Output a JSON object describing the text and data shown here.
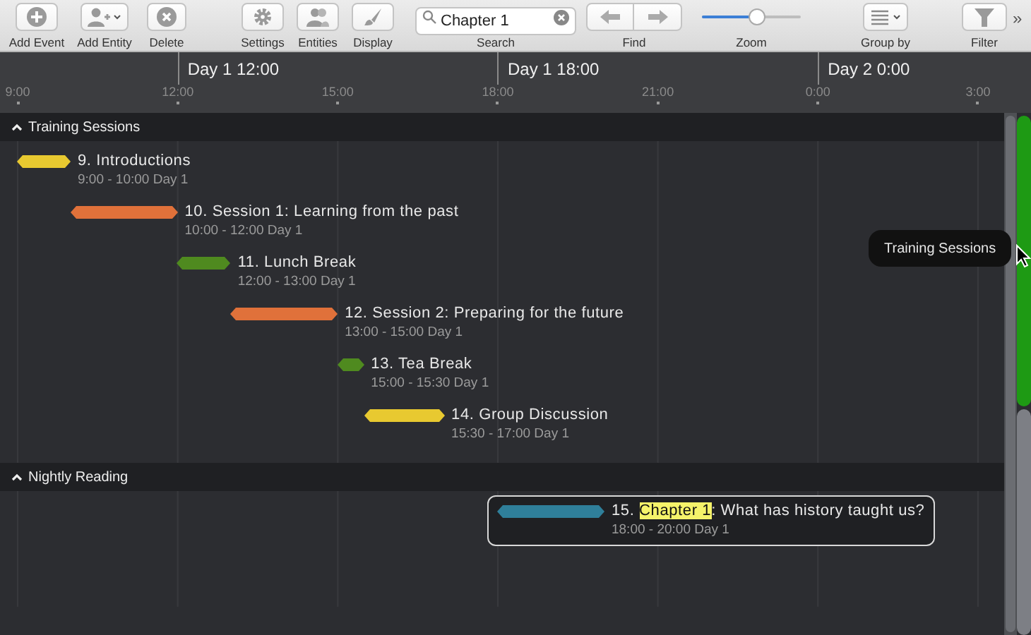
{
  "toolbar": {
    "add_event": {
      "label": "Add Event"
    },
    "add_entity": {
      "label": "Add Entity"
    },
    "delete": {
      "label": "Delete"
    },
    "settings": {
      "label": "Settings"
    },
    "entities": {
      "label": "Entities"
    },
    "display": {
      "label": "Display"
    },
    "search": {
      "value": "Chapter 1",
      "label": "Search"
    },
    "find": {
      "label": "Find"
    },
    "zoom": {
      "label": "Zoom",
      "level": 0.55
    },
    "group_by": {
      "label": "Group by"
    },
    "filter": {
      "label": "Filter"
    },
    "overflow": "»"
  },
  "timeline": {
    "day_labels": [
      "Day 1 12:00",
      "Day 1 18:00",
      "Day 2 0:00"
    ],
    "hour_ticks": [
      "9:00",
      "12:00",
      "15:00",
      "18:00",
      "21:00",
      "0:00",
      "3:00"
    ]
  },
  "groups": [
    {
      "name": "Training Sessions",
      "expanded": true,
      "events": [
        {
          "title": [
            {
              "text": "9. Introductions"
            }
          ],
          "time": "9:00 - 10:00 Day 1",
          "color": "#e8c930",
          "selected": false
        },
        {
          "title": [
            {
              "text": "10. Session 1: Learning from the past"
            }
          ],
          "time": "10:00 - 12:00 Day 1",
          "color": "#e0713a",
          "selected": false
        },
        {
          "title": [
            {
              "text": "11. Lunch Break"
            }
          ],
          "time": "12:00 - 13:00 Day 1",
          "color": "#4f8a1f",
          "selected": false
        },
        {
          "title": [
            {
              "text": "12. Session 2: Preparing for the future"
            }
          ],
          "time": "13:00 - 15:00 Day 1",
          "color": "#e0713a",
          "selected": false
        },
        {
          "title": [
            {
              "text": "13. Tea Break"
            }
          ],
          "time": "15:00 - 15:30 Day 1",
          "color": "#4f8a1f",
          "selected": false
        },
        {
          "title": [
            {
              "text": "14. Group Discussion"
            }
          ],
          "time": "15:30 - 17:00 Day 1",
          "color": "#e8c930",
          "selected": false
        }
      ]
    },
    {
      "name": "Nightly Reading",
      "expanded": true,
      "events": [
        {
          "title": [
            {
              "text": "15. "
            },
            {
              "text": "Chapter 1",
              "highlighted": true
            },
            {
              "text": ": What has history taught us?"
            }
          ],
          "time": "18:00 - 20:00 Day 1",
          "color": "#2f7f9a",
          "selected": true
        }
      ]
    }
  ],
  "tooltip": "Training Sessions"
}
